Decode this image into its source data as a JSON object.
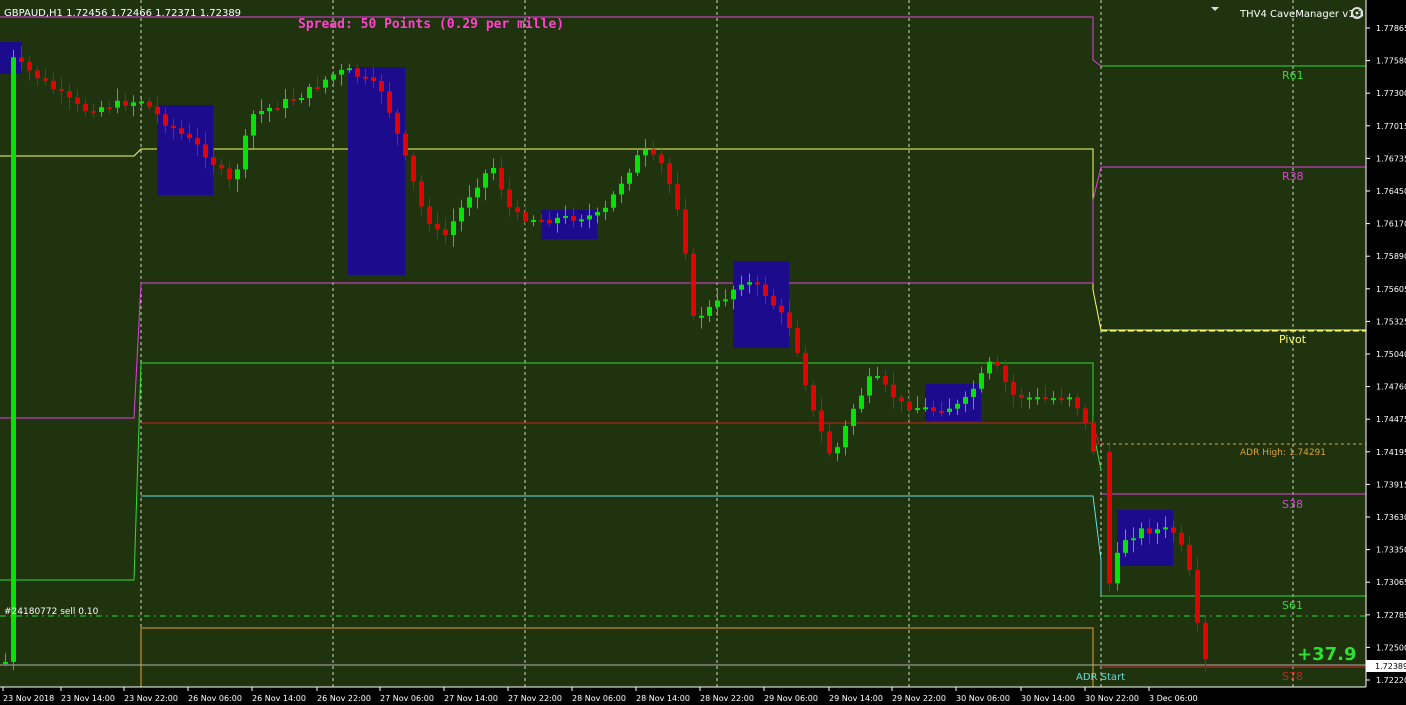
{
  "header": {
    "symbol_info": "GBPAUD,H1  1.72456 1.72466 1.72371 1.72389",
    "spread_text": "Spread: 50 Points (0.29 per mille)",
    "indicator_name": "THV4 CaveManager v1.3",
    "dropdown_icon": "triangle-down-icon",
    "settings_icon": "gear-icon"
  },
  "labels": {
    "r61": "R61",
    "r38": "R38",
    "pivot": "Pivot",
    "adr_high": "ADR High: 1.74291",
    "s38": "S38",
    "s61": "S61",
    "s78": "S78",
    "adr_start": "ADR Start",
    "profit": "+37.9",
    "order": "#24180772 sell 0.10",
    "current_price": "1.72389"
  },
  "colors": {
    "background": "#1e330e",
    "bull": "#00e600",
    "bear": "#e60000",
    "zone": "#1c0b8c",
    "magenta": "#e040e0",
    "yellow": "#ffff66",
    "green": "#33dd33",
    "red": "#cc2222",
    "cyan": "#66dddd",
    "orange": "#e0a030"
  },
  "price_axis": [
    "1.77865",
    "1.77580",
    "1.77300",
    "1.77015",
    "1.76735",
    "1.76450",
    "1.76170",
    "1.75890",
    "1.75605",
    "1.75325",
    "1.75040",
    "1.74760",
    "1.74475",
    "1.74195",
    "1.73915",
    "1.73630",
    "1.73350",
    "1.73065",
    "1.72785",
    "1.72500",
    "1.72220"
  ],
  "time_axis": [
    "23 Nov 2018",
    "23 Nov 14:00",
    "23 Nov 22:00",
    "26 Nov 06:00",
    "26 Nov 14:00",
    "26 Nov 22:00",
    "27 Nov 06:00",
    "27 Nov 14:00",
    "27 Nov 22:00",
    "28 Nov 06:00",
    "28 Nov 14:00",
    "28 Nov 22:00",
    "29 Nov 06:00",
    "29 Nov 14:00",
    "29 Nov 22:00",
    "30 Nov 06:00",
    "30 Nov 14:00",
    "30 Nov 22:00",
    "3 Dec 06:00"
  ]
}
